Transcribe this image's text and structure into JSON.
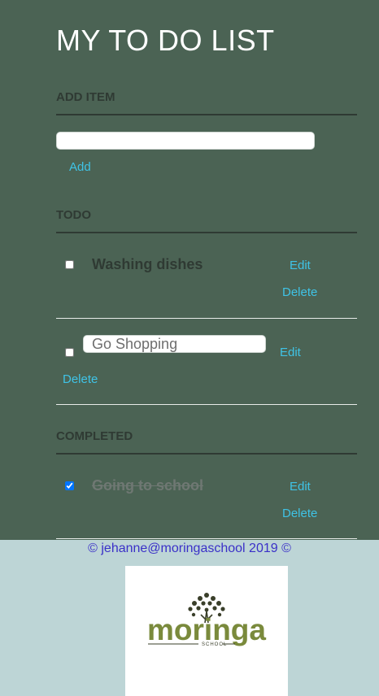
{
  "app": {
    "title": "MY TO DO LIST"
  },
  "add_section": {
    "heading": "ADD ITEM",
    "input_value": "",
    "add_label": "Add"
  },
  "todo_section": {
    "heading": "TODO",
    "items": [
      {
        "text": "Washing dishes",
        "checked": false,
        "editing": false,
        "edit_label": "Edit",
        "delete_label": "Delete"
      },
      {
        "text": "Go Shopping",
        "checked": false,
        "editing": true,
        "edit_label": "Edit",
        "delete_label": "Delete"
      }
    ]
  },
  "completed_section": {
    "heading": "COMPLETED",
    "items": [
      {
        "text": "Going to school",
        "checked": true,
        "edit_label": "Edit",
        "delete_label": "Delete"
      }
    ]
  },
  "footer": {
    "copyright": "© jehanne@moringaschool 2019 ©",
    "logo_icon": "moringa-school-logo",
    "logo_word": "moringa",
    "logo_sub": "SCHOOL"
  },
  "colors": {
    "app_background": "#4b6354",
    "page_background": "#bdd5d6",
    "link": "#3fc3e6",
    "footer_text": "#3a30c8",
    "logo_green": "#7a8a3c",
    "logo_dark": "#3a3f2a"
  }
}
